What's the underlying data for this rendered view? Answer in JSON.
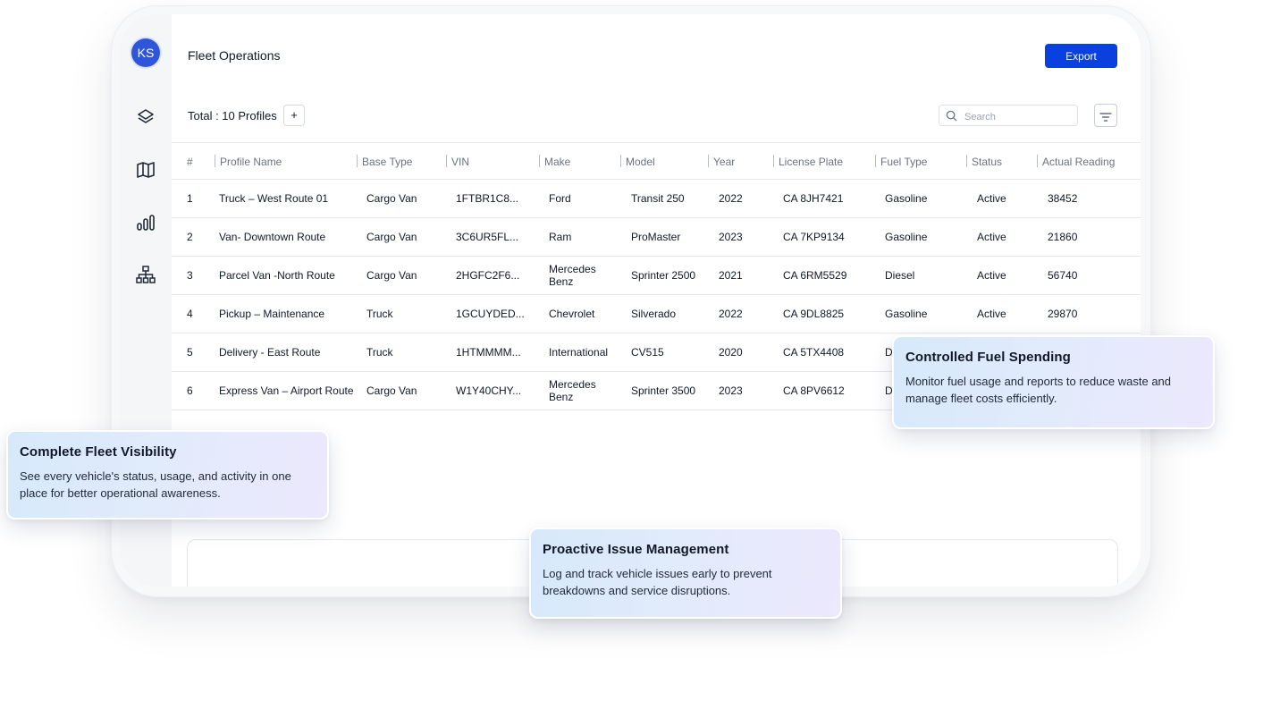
{
  "sidebar": {
    "avatar_initials": "KS",
    "icons": [
      "layers-icon",
      "map-icon",
      "bar-chart-icon",
      "org-chart-icon"
    ]
  },
  "header": {
    "title": "Fleet Operations",
    "export_label": "Export"
  },
  "toolbar": {
    "total_label": "Total : 10 Profiles",
    "add_label": "+",
    "search_placeholder": "Search"
  },
  "table": {
    "columns": [
      "#",
      "Profile Name",
      "Base Type",
      "VIN",
      "Make",
      "Model",
      "Year",
      "License Plate",
      "Fuel Type",
      "Status",
      "Actual Reading"
    ],
    "rows": [
      [
        "1",
        "Truck – West Route 01",
        "Cargo Van",
        "1FTBR1C8...",
        "Ford",
        "Transit 250",
        "2022",
        "CA 8JH7421",
        "Gasoline",
        "Active",
        "38452"
      ],
      [
        "2",
        "Van- Downtown Route",
        "Cargo Van",
        "3C6UR5FL...",
        "Ram",
        "ProMaster",
        "2023",
        "CA 7KP9134",
        "Gasoline",
        "Active",
        "21860"
      ],
      [
        "3",
        "Parcel Van -North Route",
        "Cargo Van",
        "2HGFC2F6...",
        "Mercedes Benz",
        "Sprinter 2500",
        "2021",
        "CA 6RM5529",
        "Diesel",
        "Active",
        "56740"
      ],
      [
        "4",
        "Pickup – Maintenance",
        "Truck",
        "1GCUYDED...",
        "Chevrolet",
        "Silverado",
        "2022",
        "CA 9DL8825",
        "Gasoline",
        "Active",
        "29870"
      ],
      [
        "5",
        "Delivery - East Route",
        "Truck",
        "1HTMMMM...",
        "International",
        "CV515",
        "2020",
        "CA 5TX4408",
        "D",
        "",
        ""
      ],
      [
        "6",
        "Express Van – Airport Route",
        "Cargo Van",
        "W1Y40CHY...",
        "Mercedes Benz",
        "Sprinter 3500",
        "2023",
        "CA 8PV6612",
        "D",
        "",
        ""
      ]
    ]
  },
  "callouts": {
    "fuel": {
      "title": "Controlled Fuel Spending",
      "body": "Monitor fuel usage and reports to reduce waste and manage fleet costs efficiently."
    },
    "visibility": {
      "title": "Complete Fleet Visibility",
      "body": "See every vehicle's status, usage, and activity in one place for better operational awareness."
    },
    "issues": {
      "title": "Proactive Issue Management",
      "body": "Log and track vehicle issues early to prevent breakdowns and service disruptions."
    }
  },
  "colors": {
    "accent": "#0a3fe0",
    "avatar": "#2f56d9"
  }
}
